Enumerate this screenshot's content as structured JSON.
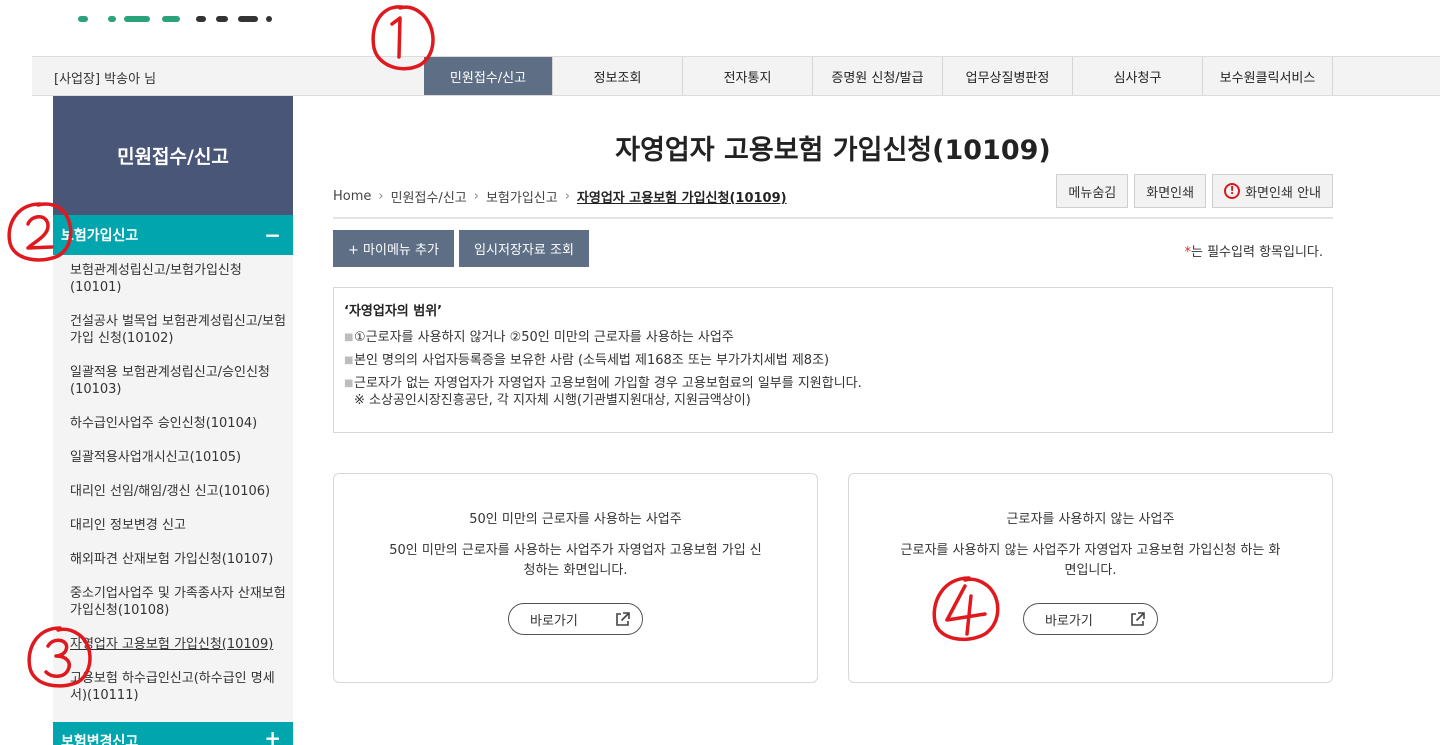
{
  "gnb": {
    "user": "[사업장] 박송아 님",
    "menu": [
      {
        "label": "민원접수/신고",
        "active": true
      },
      {
        "label": "정보조회",
        "active": false
      },
      {
        "label": "전자통지",
        "active": false
      },
      {
        "label": "증명원 신청/발급",
        "active": false
      },
      {
        "label": "업무상질병판정",
        "active": false
      },
      {
        "label": "심사청구",
        "active": false
      },
      {
        "label": "보수원클릭서비스",
        "active": false
      }
    ]
  },
  "sidebar": {
    "title": "민원접수/신고",
    "category": "보험가입신고",
    "category_sign": "−",
    "items": [
      "보험관계성립신고/보험가입신청(10101)",
      "건설공사 벌목업 보험관계성립신고/보험가입 신청(10102)",
      "일괄적용 보험관계성립신고/승인신청(10103)",
      "하수급인사업주 승인신청(10104)",
      "일괄적용사업개시신고(10105)",
      "대리인 선임/해임/갱신 신고(10106)",
      "대리인 정보변경 신고",
      "해외파견 산재보험 가입신청(10107)",
      "중소기업사업주 및 가족종사자 산재보험가입신청(10108)",
      "자영업자 고용보험 가입신청(10109)",
      "고용보험 하수급인신고(하수급인 명세서)(10111)"
    ],
    "current_item": "자영업자 고용보험 가입신청(10109)",
    "category2": "보험변경신고",
    "category2_sign": "+"
  },
  "content": {
    "title": "자영업자 고용보험 가입신청(10109)",
    "breadcrumb": [
      "Home",
      "민원접수/신고",
      "보험가입신고",
      "자영업자 고용보험 가입신청(10109)"
    ],
    "buttons": {
      "hide_menu": "메뉴숨김",
      "print": "화면인쇄",
      "print_guide": "화면인쇄 안내",
      "add_my_menu": "+ 마이메뉴 추가",
      "temp_saved": "임시저장자료 조회"
    },
    "required_note_star": "*",
    "required_note": "는 필수입력 항목입니다.",
    "info": {
      "heading": "‘자영업자의 범위’",
      "lines": [
        "①근로자를 사용하지 않거나 ②50인 미만의 근로자를 사용하는 사업주",
        "본인 명의의 사업자등록증을 보유한 사람 (소득세법 제168조 또는 부가가치세법 제8조)",
        "근로자가 없는 자영업자가 자영업자 고용보험에 가입할 경우 고용보험료의 일부를 지원합니다."
      ],
      "sub": "※ 소상공인시장진흥공단, 각 지자체 시행(기관별지원대상, 지원금액상이)"
    },
    "cards": [
      {
        "title": "50인 미만의 근로자를 사용하는 사업주",
        "desc": "50인 미만의 근로자를 사용하는 사업주가 자영업자 고용보험 가입 신청하는 화면입니다.",
        "button": "바로가기"
      },
      {
        "title": "근로자를 사용하지 않는 사업주",
        "desc": "근로자를 사용하지 않는 사업주가 자영업자 고용보험 가입신청 하는 화면입니다.",
        "button": "바로가기"
      }
    ]
  },
  "colors": {
    "gnb_active": "#5d6e85",
    "sidebar_title_bg": "#4a5677",
    "sidebar_category_bg": "#00a5ad",
    "annotation_red": "#e0191f",
    "warn_red": "#d7191f"
  }
}
